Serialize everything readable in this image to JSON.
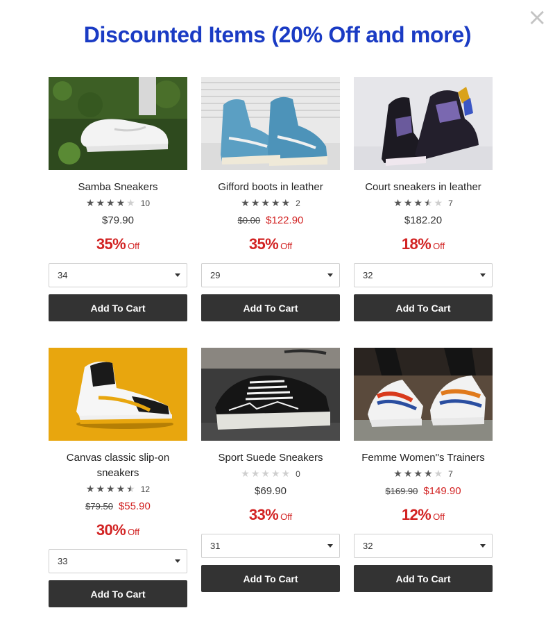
{
  "modal": {
    "title": "Discounted Items (20% Off and more)",
    "close_symbol": "×"
  },
  "colors": {
    "title": "#1a3bc4",
    "sale": "#d22323",
    "button": "#333333"
  },
  "products": [
    {
      "name": "Samba Sneakers",
      "image_icon": "white-sneaker-photo",
      "stars": [
        "full",
        "full",
        "full",
        "full",
        "empty"
      ],
      "rating_count": "10",
      "old_price": "",
      "price": "$79.90",
      "discount_pct": "35%",
      "discount_suffix": "Off",
      "size": "34",
      "cart_label": "Add To Cart"
    },
    {
      "name": "Gifford boots in leather",
      "image_icon": "blue-hightop-photo",
      "stars": [
        "full",
        "full",
        "full",
        "full",
        "full"
      ],
      "rating_count": "2",
      "old_price": "$0.00",
      "price": "$122.90",
      "discount_pct": "35%",
      "discount_suffix": "Off",
      "size": "29",
      "cart_label": "Add To Cart"
    },
    {
      "name": "Court sneakers in leather",
      "image_icon": "black-hightop-photo",
      "stars": [
        "full",
        "full",
        "full",
        "half",
        "empty"
      ],
      "rating_count": "7",
      "old_price": "",
      "price": "$182.20",
      "discount_pct": "18%",
      "discount_suffix": "Off",
      "size": "32",
      "cart_label": "Add To Cart"
    },
    {
      "name": "Canvas classic slip-on sneakers",
      "image_icon": "yellow-hightop-photo",
      "stars": [
        "full",
        "full",
        "full",
        "full",
        "half"
      ],
      "rating_count": "12",
      "old_price": "$79.50",
      "price": "$55.90",
      "discount_pct": "30%",
      "discount_suffix": "Off",
      "size": "33",
      "cart_label": "Add To Cart"
    },
    {
      "name": "Sport Suede Sneakers",
      "image_icon": "black-lowtop-photo",
      "stars": [
        "empty",
        "empty",
        "empty",
        "empty",
        "empty"
      ],
      "rating_count": "0",
      "old_price": "",
      "price": "$69.90",
      "discount_pct": "33%",
      "discount_suffix": "Off",
      "size": "31",
      "cart_label": "Add To Cart"
    },
    {
      "name": "Femme Women\"s Trainers",
      "image_icon": "ellesse-trainer-photo",
      "stars": [
        "full",
        "full",
        "full",
        "full",
        "empty"
      ],
      "rating_count": "7",
      "old_price": "$169.90",
      "price": "$149.90",
      "discount_pct": "12%",
      "discount_suffix": "Off",
      "size": "32",
      "cart_label": "Add To Cart"
    }
  ]
}
